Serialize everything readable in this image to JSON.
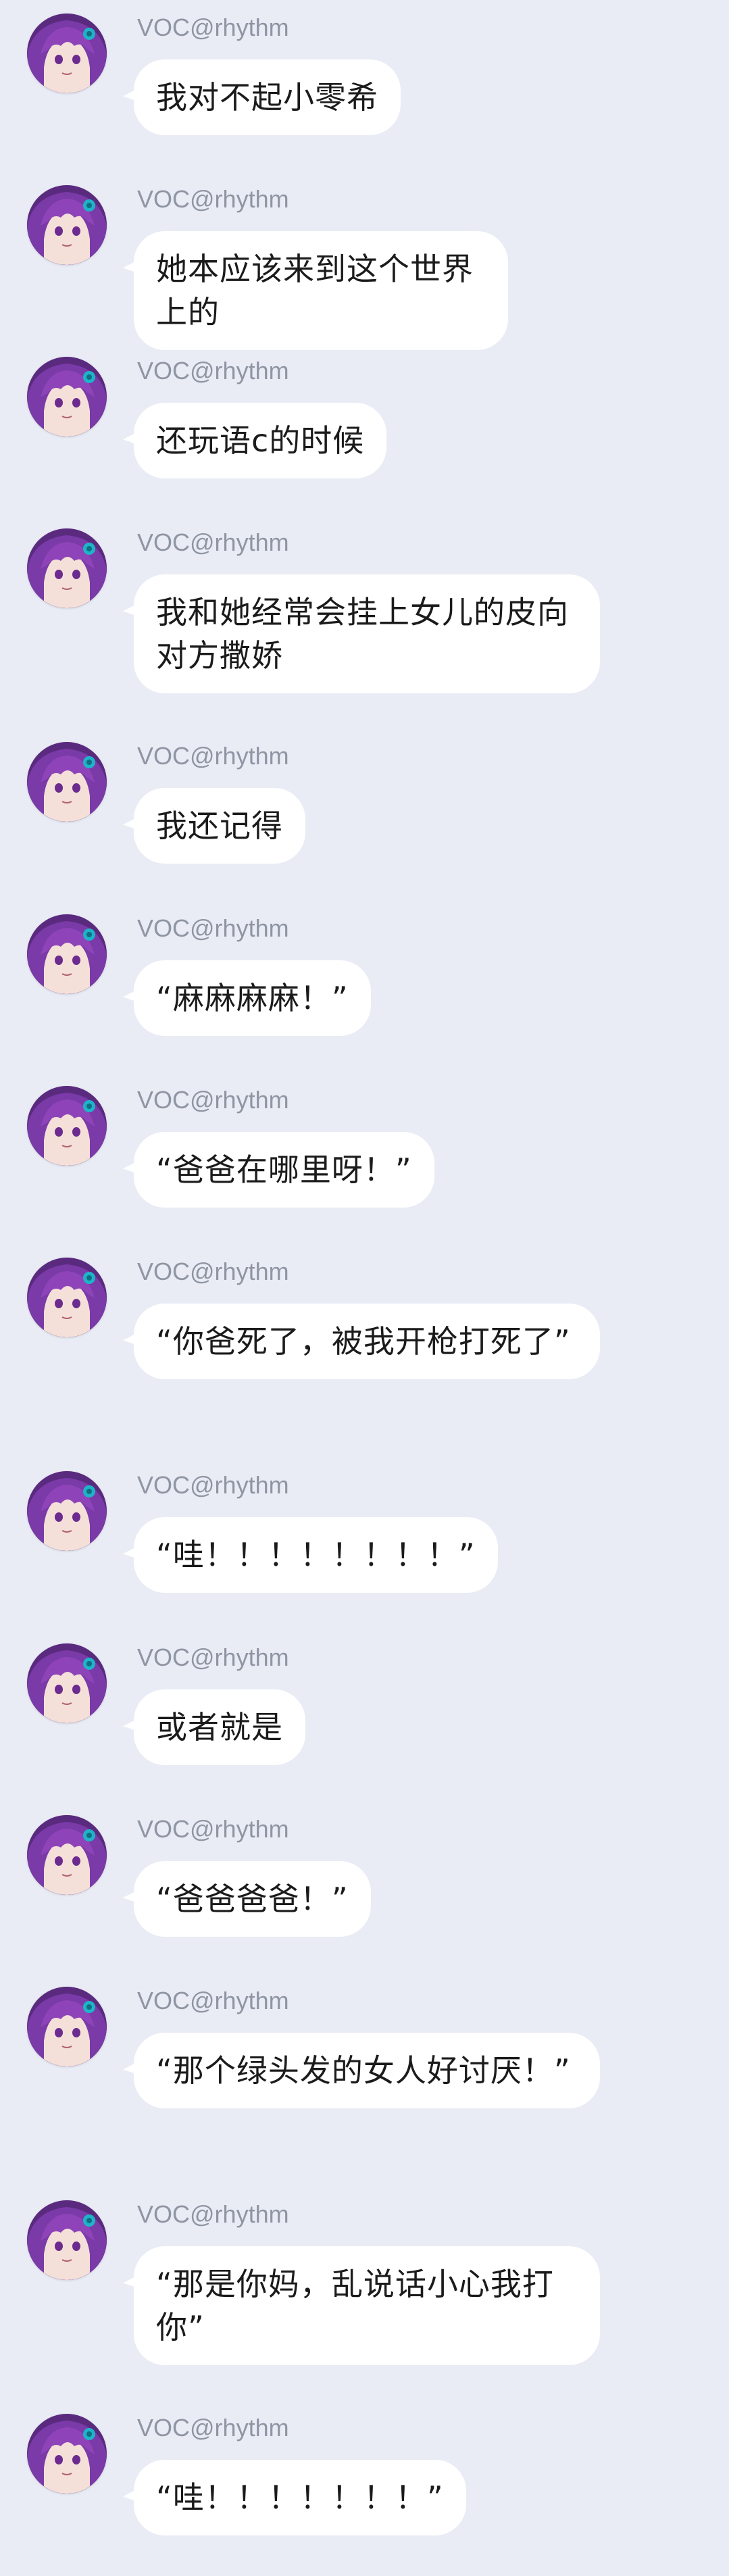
{
  "sender_name": "VOC@rhythm",
  "avatar_icon": "anime-avatar-purple-hair",
  "colors": {
    "background": "#e9ecf5",
    "bubble": "#ffffff",
    "sender_text": "#8f95a3",
    "message_text": "#1b1b1b",
    "avatar_hair": "#7d3fa6",
    "avatar_accent": "#1fb3c9"
  },
  "messages": [
    {
      "text": "我对不起小零希"
    },
    {
      "text": "她本应该来到这个世界上的"
    },
    {
      "text": "还玩语c的时候"
    },
    {
      "text": "我和她经常会挂上女儿的皮向对方撒娇"
    },
    {
      "text": "我还记得"
    },
    {
      "text": "“麻麻麻麻！”"
    },
    {
      "text": "“爸爸在哪里呀！”"
    },
    {
      "text": "“你爸死了，被我开枪打死了”"
    },
    {
      "text": "“哇！！！！！！！！”"
    },
    {
      "text": "或者就是"
    },
    {
      "text": "“爸爸爸爸！”"
    },
    {
      "text": "“那个绿头发的女人好讨厌！”"
    },
    {
      "text": "“那是你妈，乱说话小心我打你”"
    },
    {
      "text": "“哇！！！！！！！”"
    }
  ]
}
